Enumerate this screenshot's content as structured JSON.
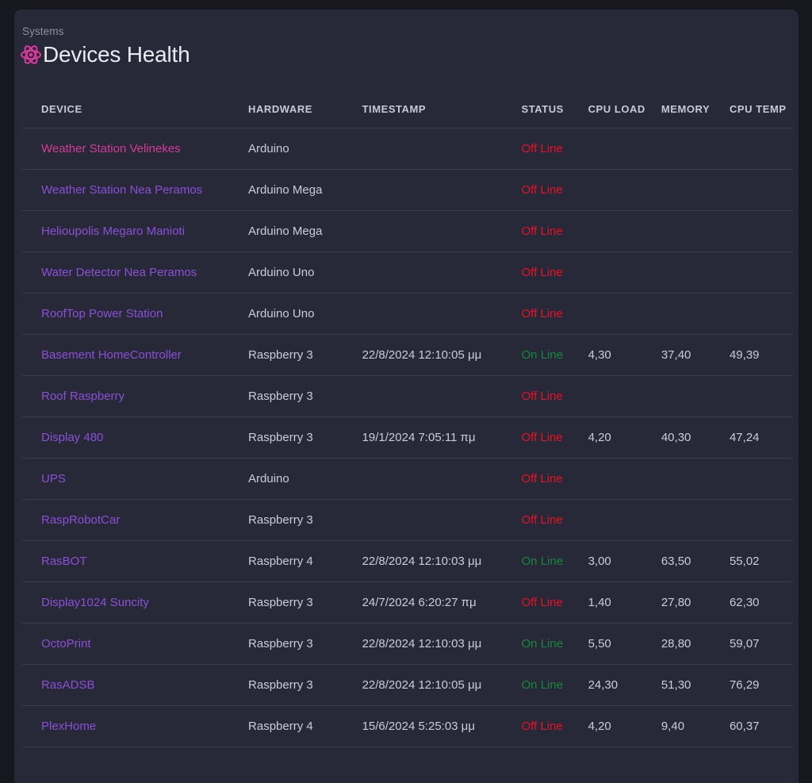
{
  "window": {
    "background_color": "#17171f",
    "card_color": "#272938"
  },
  "header": {
    "breadcrumb": "Systems",
    "title": "Devices Health",
    "icon": "atom-icon",
    "icon_color": "#e0399e",
    "accent_color": "#d23c97",
    "link_color": "#8b4fd6"
  },
  "table": {
    "columns": [
      {
        "key": "device",
        "label": "DEVICE"
      },
      {
        "key": "hardware",
        "label": "HARDWARE"
      },
      {
        "key": "timestamp",
        "label": "TIMESTAMP"
      },
      {
        "key": "status",
        "label": "STATUS"
      },
      {
        "key": "cpu_load",
        "label": "CPU LOAD"
      },
      {
        "key": "memory",
        "label": "MEMORY"
      },
      {
        "key": "cpu_temp",
        "label": "CPU TEMP"
      }
    ],
    "status_labels": {
      "online": "On Line",
      "offline": "Off Line"
    },
    "status_colors": {
      "online": "#17883a",
      "offline": "#e81123"
    },
    "rows": [
      {
        "device": "Weather Station Velinekes",
        "hardware": "Arduino",
        "timestamp": "",
        "status": "Off Line",
        "cpu_load": "",
        "memory": "",
        "cpu_temp": ""
      },
      {
        "device": "Weather Station Nea Peramos",
        "hardware": "Arduino Mega",
        "timestamp": "",
        "status": "Off Line",
        "cpu_load": "",
        "memory": "",
        "cpu_temp": ""
      },
      {
        "device": "Helioupolis Megaro Manioti",
        "hardware": "Arduino Mega",
        "timestamp": "",
        "status": "Off Line",
        "cpu_load": "",
        "memory": "",
        "cpu_temp": ""
      },
      {
        "device": "Water Detector Nea Peramos",
        "hardware": "Arduino Uno",
        "timestamp": "",
        "status": "Off Line",
        "cpu_load": "",
        "memory": "",
        "cpu_temp": ""
      },
      {
        "device": "RoofTop Power Station",
        "hardware": "Arduino Uno",
        "timestamp": "",
        "status": "Off Line",
        "cpu_load": "",
        "memory": "",
        "cpu_temp": ""
      },
      {
        "device": "Basement HomeController",
        "hardware": "Raspberry 3",
        "timestamp": "22/8/2024 12:10:05 μμ",
        "status": "On Line",
        "cpu_load": "4,30",
        "memory": "37,40",
        "cpu_temp": "49,39"
      },
      {
        "device": "Roof Raspberry",
        "hardware": "Raspberry 3",
        "timestamp": "",
        "status": "Off Line",
        "cpu_load": "",
        "memory": "",
        "cpu_temp": ""
      },
      {
        "device": "Display 480",
        "hardware": "Raspberry 3",
        "timestamp": "19/1/2024 7:05:11 πμ",
        "status": "Off Line",
        "cpu_load": "4,20",
        "memory": "40,30",
        "cpu_temp": "47,24"
      },
      {
        "device": "UPS",
        "hardware": "Arduino",
        "timestamp": "",
        "status": "Off Line",
        "cpu_load": "",
        "memory": "",
        "cpu_temp": ""
      },
      {
        "device": "RaspRobotCar",
        "hardware": "Raspberry 3",
        "timestamp": "",
        "status": "Off Line",
        "cpu_load": "",
        "memory": "",
        "cpu_temp": ""
      },
      {
        "device": "RasBOT",
        "hardware": "Raspberry 4",
        "timestamp": "22/8/2024 12:10:03 μμ",
        "status": "On Line",
        "cpu_load": "3,00",
        "memory": "63,50",
        "cpu_temp": "55,02"
      },
      {
        "device": "Display1024 Suncity",
        "hardware": "Raspberry 3",
        "timestamp": "24/7/2024 6:20:27 πμ",
        "status": "Off Line",
        "cpu_load": "1,40",
        "memory": "27,80",
        "cpu_temp": "62,30"
      },
      {
        "device": "OctoPrint",
        "hardware": "Raspberry 3",
        "timestamp": "22/8/2024 12:10:03 μμ",
        "status": "On Line",
        "cpu_load": "5,50",
        "memory": "28,80",
        "cpu_temp": "59,07"
      },
      {
        "device": "RasADSB",
        "hardware": "Raspberry 3",
        "timestamp": "22/8/2024 12:10:05 μμ",
        "status": "On Line",
        "cpu_load": "24,30",
        "memory": "51,30",
        "cpu_temp": "76,29"
      },
      {
        "device": "PlexHome",
        "hardware": "Raspberry 4",
        "timestamp": "15/6/2024 5:25:03 μμ",
        "status": "Off Line",
        "cpu_load": "4,20",
        "memory": "9,40",
        "cpu_temp": "60,37"
      }
    ]
  }
}
